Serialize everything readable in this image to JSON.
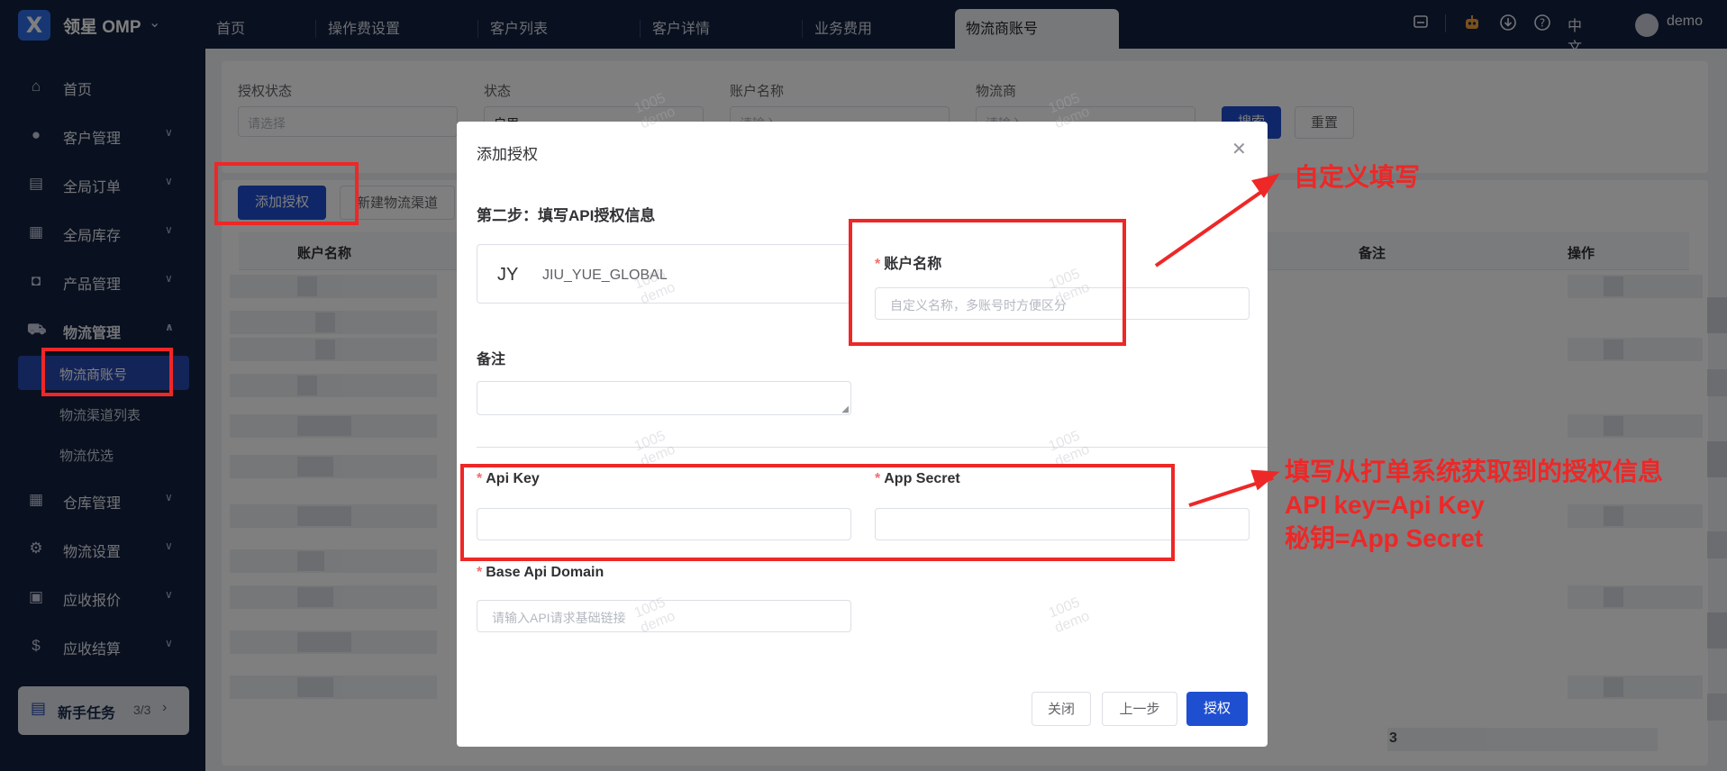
{
  "app": {
    "brand": "领星 OMP",
    "logo": "X"
  },
  "tabs": [
    "首页",
    "操作费设置",
    "客户列表",
    "客户详情",
    "业务费用",
    "物流商账号"
  ],
  "topbar_right": {
    "lang": "中文",
    "user": "demo"
  },
  "sidebar": {
    "items": [
      {
        "label": "首页",
        "icon": "home-icon"
      },
      {
        "label": "客户管理",
        "icon": "users-icon"
      },
      {
        "label": "全局订单",
        "icon": "clipboard-icon"
      },
      {
        "label": "全局库存",
        "icon": "warehouse-icon"
      },
      {
        "label": "产品管理",
        "icon": "bag-icon"
      },
      {
        "label": "物流管理",
        "icon": "truck-icon"
      },
      {
        "label": "仓库管理",
        "icon": "warehouse-icon"
      },
      {
        "label": "物流设置",
        "icon": "box-gear-icon"
      },
      {
        "label": "应收报价",
        "icon": "document-icon"
      },
      {
        "label": "应收结算",
        "icon": "coin-icon"
      }
    ],
    "subitems": [
      "物流商账号",
      "物流渠道列表",
      "物流优选"
    ],
    "task": {
      "label": "新手任务",
      "count": "3/3"
    }
  },
  "filters": {
    "auth_status": {
      "label": "授权状态",
      "placeholder": "请选择"
    },
    "status": {
      "label": "状态",
      "value": "启用"
    },
    "account_name": {
      "label": "账户名称",
      "placeholder": "请输入"
    },
    "carrier": {
      "label": "物流商",
      "placeholder": "请输入"
    },
    "search_btn": "搜索",
    "reset_btn": "重置"
  },
  "toolbar": {
    "add_auth": "添加授权",
    "new_channel": "新建物流渠道"
  },
  "table": {
    "headers": [
      "账户名称",
      "备注",
      "操作"
    ],
    "page": "3"
  },
  "modal": {
    "title": "添加授权",
    "step": "第二步：填写API授权信息",
    "carrier_abbr": "JY",
    "carrier_name": "JIU_YUE_GLOBAL",
    "account_label": "账户名称",
    "account_placeholder": "自定义名称，多账号时方便区分",
    "remark_label": "备注",
    "api_key_label": "Api Key",
    "app_secret_label": "App Secret",
    "base_domain_label": "Base Api Domain",
    "base_domain_placeholder": "请输入API请求基础链接",
    "close_btn": "关闭",
    "prev_btn": "上一步",
    "auth_btn": "授权"
  },
  "watermark": {
    "line1": "1005",
    "line2": "demo"
  },
  "annotations": {
    "custom_fill": "自定义填写",
    "auth_info_1": "填写从打单系统获取到的授权信息",
    "auth_info_2": "API key=Api Key",
    "auth_info_3": "秘钥=App Secret"
  },
  "colors": {
    "primary": "#1f4fd1",
    "annotation": "#ee2727",
    "nav_bg": "#13203f"
  }
}
